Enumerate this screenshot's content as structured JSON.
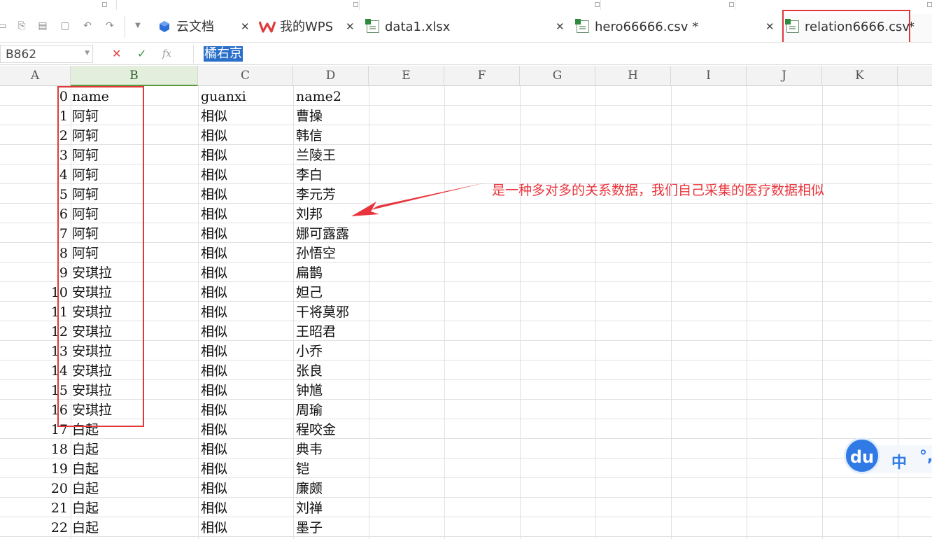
{
  "tabs": [
    {
      "label": "云文档",
      "icon": "cloud-doc-icon"
    },
    {
      "label": "我的WPS",
      "icon": "wps-logo-icon"
    },
    {
      "label": "data1.xlsx",
      "icon": "spreadsheet-file-icon"
    },
    {
      "label": "hero66666.csv *",
      "icon": "spreadsheet-file-icon"
    },
    {
      "label": "relation6666.csv",
      "icon": "spreadsheet-file-icon"
    }
  ],
  "active_tab_suffix": "*",
  "formula_bar": {
    "name_box": "B862",
    "cancel_symbol": "✕",
    "confirm_symbol": "✓",
    "fx_symbol": "fx",
    "value": "橘右京"
  },
  "columns": [
    "A",
    "B",
    "C",
    "D",
    "E",
    "F",
    "G",
    "H",
    "I",
    "J",
    "K"
  ],
  "selected_column": "B",
  "rows": [
    {
      "a": "0",
      "b": "name",
      "c": "guanxi",
      "d": "name2"
    },
    {
      "a": "1",
      "b": "阿轲",
      "c": "相似",
      "d": "曹操"
    },
    {
      "a": "2",
      "b": "阿轲",
      "c": "相似",
      "d": "韩信"
    },
    {
      "a": "3",
      "b": "阿轲",
      "c": "相似",
      "d": "兰陵王"
    },
    {
      "a": "4",
      "b": "阿轲",
      "c": "相似",
      "d": "李白"
    },
    {
      "a": "5",
      "b": "阿轲",
      "c": "相似",
      "d": "李元芳"
    },
    {
      "a": "6",
      "b": "阿轲",
      "c": "相似",
      "d": "刘邦"
    },
    {
      "a": "7",
      "b": "阿轲",
      "c": "相似",
      "d": "娜可露露"
    },
    {
      "a": "8",
      "b": "阿轲",
      "c": "相似",
      "d": "孙悟空"
    },
    {
      "a": "9",
      "b": "安琪拉",
      "c": "相似",
      "d": "扁鹊"
    },
    {
      "a": "10",
      "b": "安琪拉",
      "c": "相似",
      "d": "妲己"
    },
    {
      "a": "11",
      "b": "安琪拉",
      "c": "相似",
      "d": "干将莫邪"
    },
    {
      "a": "12",
      "b": "安琪拉",
      "c": "相似",
      "d": "王昭君"
    },
    {
      "a": "13",
      "b": "安琪拉",
      "c": "相似",
      "d": "小乔"
    },
    {
      "a": "14",
      "b": "安琪拉",
      "c": "相似",
      "d": "张良"
    },
    {
      "a": "15",
      "b": "安琪拉",
      "c": "相似",
      "d": "钟馗"
    },
    {
      "a": "16",
      "b": "安琪拉",
      "c": "相似",
      "d": "周瑜"
    },
    {
      "a": "17",
      "b": "白起",
      "c": "相似",
      "d": "程咬金"
    },
    {
      "a": "18",
      "b": "白起",
      "c": "相似",
      "d": "典韦"
    },
    {
      "a": "19",
      "b": "白起",
      "c": "相似",
      "d": "铠"
    },
    {
      "a": "20",
      "b": "白起",
      "c": "相似",
      "d": "廉颇"
    },
    {
      "a": "21",
      "b": "白起",
      "c": "相似",
      "d": "刘禅"
    },
    {
      "a": "22",
      "b": "白起",
      "c": "相似",
      "d": "墨子"
    }
  ],
  "annotation": "是一种多对多的关系数据，我们自己采集的医疗数据相似",
  "ime": {
    "logo": "du",
    "mode": "中",
    "punct": "°,"
  },
  "colors": {
    "highlight_red": "#e0393c",
    "annotation_red": "#e8343c",
    "selection_blue": "#2a6fc9",
    "ime_blue": "#2f7ae5"
  }
}
